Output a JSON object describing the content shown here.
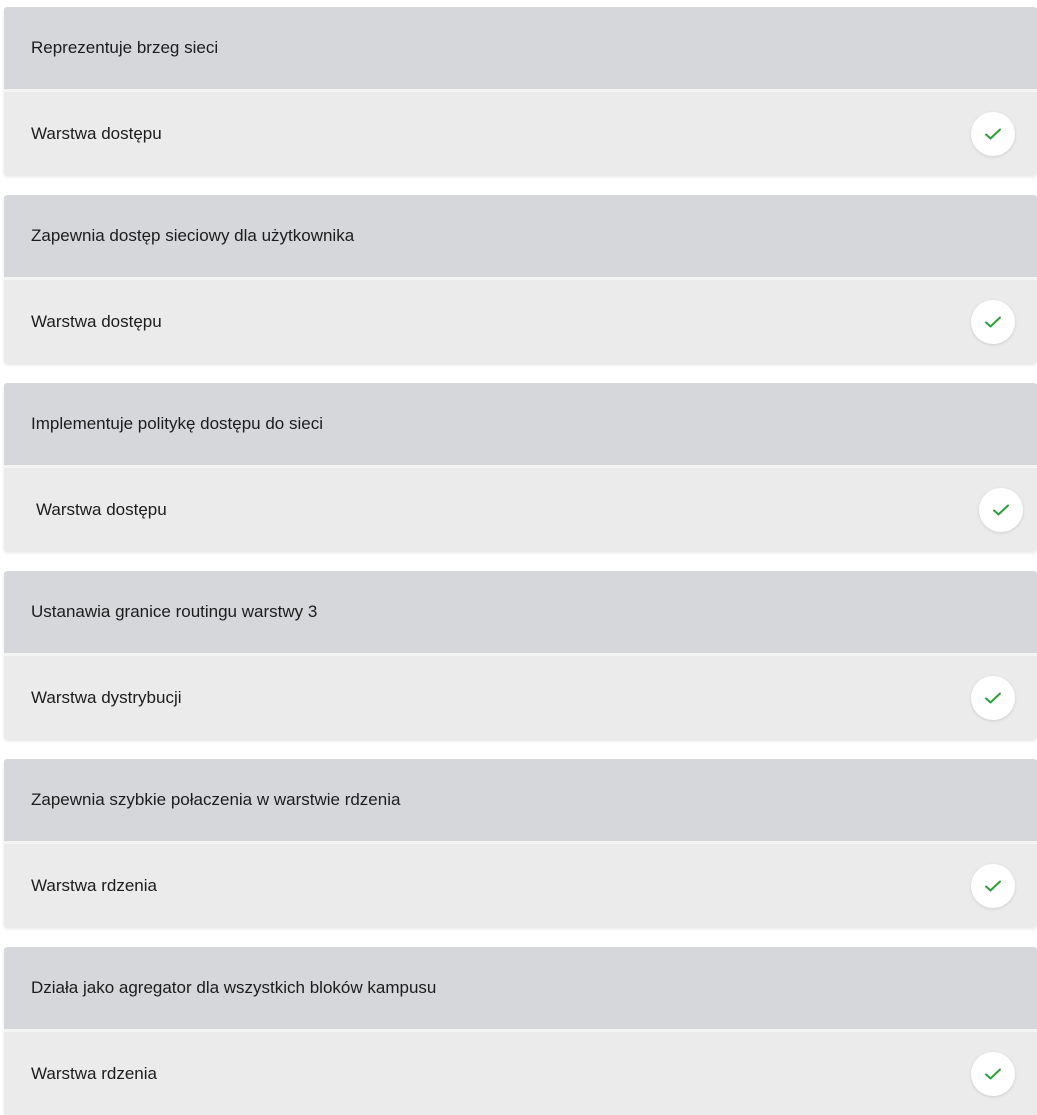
{
  "accent_color": "#2e9e3a",
  "items": [
    {
      "prompt": "Reprezentuje brzeg sieci",
      "answer": "Warstwa dostępu",
      "status_icon": "check-icon"
    },
    {
      "prompt": "Zapewnia dostęp sieciowy dla użytkownika",
      "answer": "Warstwa dostępu",
      "status_icon": "check-icon"
    },
    {
      "prompt": "Implementuje politykę dostępu do sieci",
      "answer": "Warstwa dostępu",
      "status_icon": "check-icon"
    },
    {
      "prompt": "Ustanawia granice routingu warstwy 3",
      "answer": "Warstwa dystrybucji",
      "status_icon": "check-icon"
    },
    {
      "prompt": "Zapewnia szybkie połaczenia w warstwie rdzenia",
      "answer": "Warstwa rdzenia",
      "status_icon": "check-icon"
    },
    {
      "prompt": "Działa jako agregator dla wszystkich bloków kampusu",
      "answer": "Warstwa rdzenia",
      "status_icon": "check-icon"
    }
  ]
}
